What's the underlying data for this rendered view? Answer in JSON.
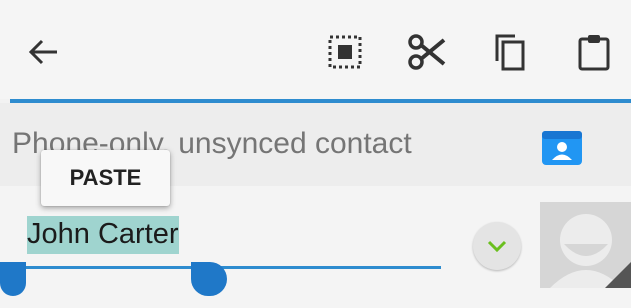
{
  "toolbar": {
    "back_icon": "arrow-left-icon",
    "actions": [
      {
        "name": "select-all",
        "icon": "select-all-icon"
      },
      {
        "name": "cut",
        "icon": "scissors-icon"
      },
      {
        "name": "copy",
        "icon": "copy-icon"
      },
      {
        "name": "paste",
        "icon": "clipboard-icon"
      }
    ]
  },
  "account": {
    "label": "Phone-only, unsynced contact",
    "icon": "contact-card-icon",
    "icon_color": "#2196f3"
  },
  "popup": {
    "paste_label": "PASTE"
  },
  "name_field": {
    "value": "John Carter"
  },
  "expand_icon": "chevron-down-icon",
  "avatar_icon": "person-placeholder-icon",
  "colors": {
    "accent": "#2e8ccf",
    "selection": "#9fd4cf",
    "handle": "#1f78c8",
    "chevron": "#6abf1e"
  }
}
